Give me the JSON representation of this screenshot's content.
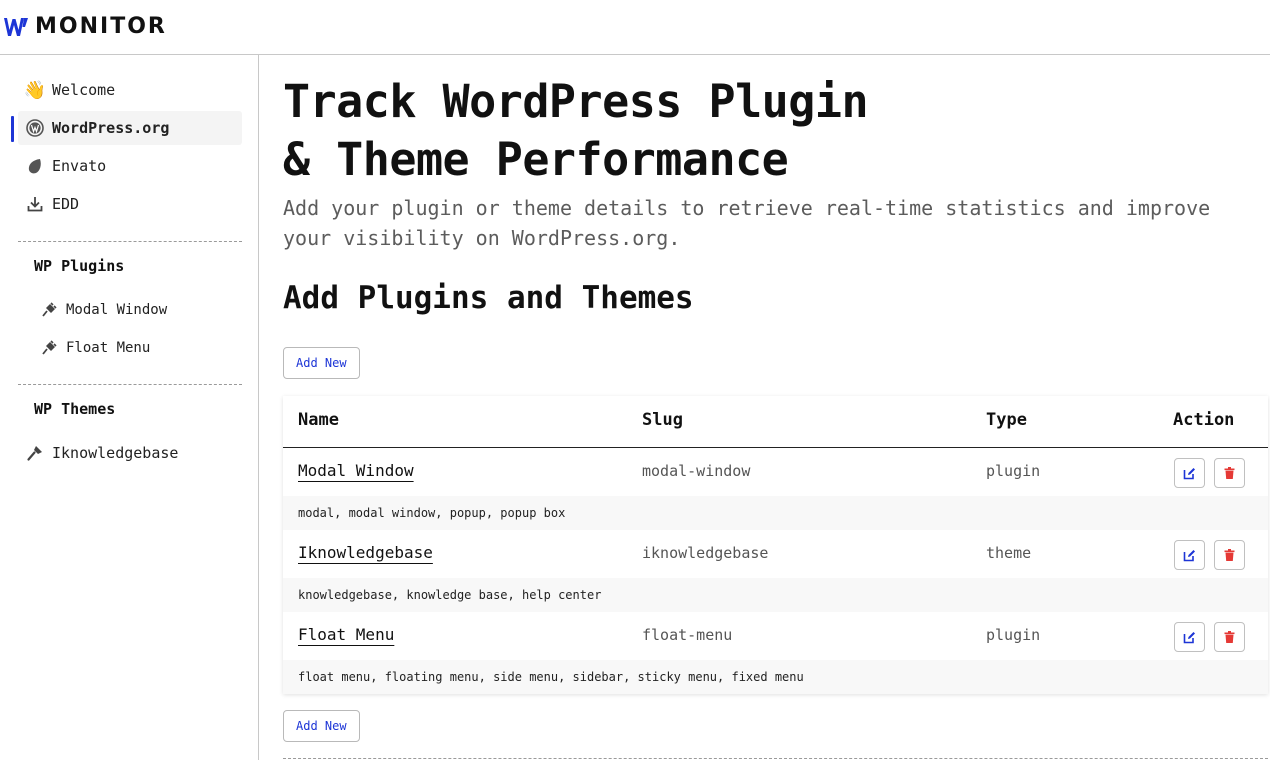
{
  "brand": {
    "name": "MONITOR"
  },
  "sidebar": {
    "main_items": [
      {
        "label": "Welcome",
        "icon": "waving-hand-icon"
      },
      {
        "label": "WordPress.org",
        "icon": "wordpress-icon",
        "active": true
      },
      {
        "label": "Envato",
        "icon": "envato-leaf-icon"
      },
      {
        "label": "EDD",
        "icon": "download-icon"
      }
    ],
    "plugins_title": "WP Plugins",
    "plugins": [
      {
        "label": "Modal Window",
        "icon": "plug-icon"
      },
      {
        "label": "Float Menu",
        "icon": "plug-icon"
      }
    ],
    "themes_title": "WP Themes",
    "themes": [
      {
        "label": "Iknowledgebase",
        "icon": "brush-icon"
      }
    ]
  },
  "main": {
    "title_line1": "Track WordPress Plugin",
    "title_line2": "& Theme Performance",
    "subtitle": "Add your plugin or theme details to retrieve real-time statistics and improve your visibility on WordPress.org.",
    "section_title": "Add Plugins and Themes",
    "add_new_label": "Add New",
    "table": {
      "headers": {
        "name": "Name",
        "slug": "Slug",
        "type": "Type",
        "action": "Action"
      },
      "rows": [
        {
          "name": "Modal Window",
          "slug": "modal-window",
          "type": "plugin",
          "tags": "modal, modal window, popup, popup box"
        },
        {
          "name": "Iknowledgebase",
          "slug": "iknowledgebase",
          "type": "theme",
          "tags": "knowledgebase, knowledge base, help center"
        },
        {
          "name": "Float Menu",
          "slug": "float-menu",
          "type": "plugin",
          "tags": "float menu, floating menu, side menu, sidebar, sticky menu, fixed menu"
        }
      ]
    }
  },
  "colors": {
    "accent": "#1d35d6",
    "danger": "#e53935",
    "muted_text": "#5c5c5c"
  }
}
